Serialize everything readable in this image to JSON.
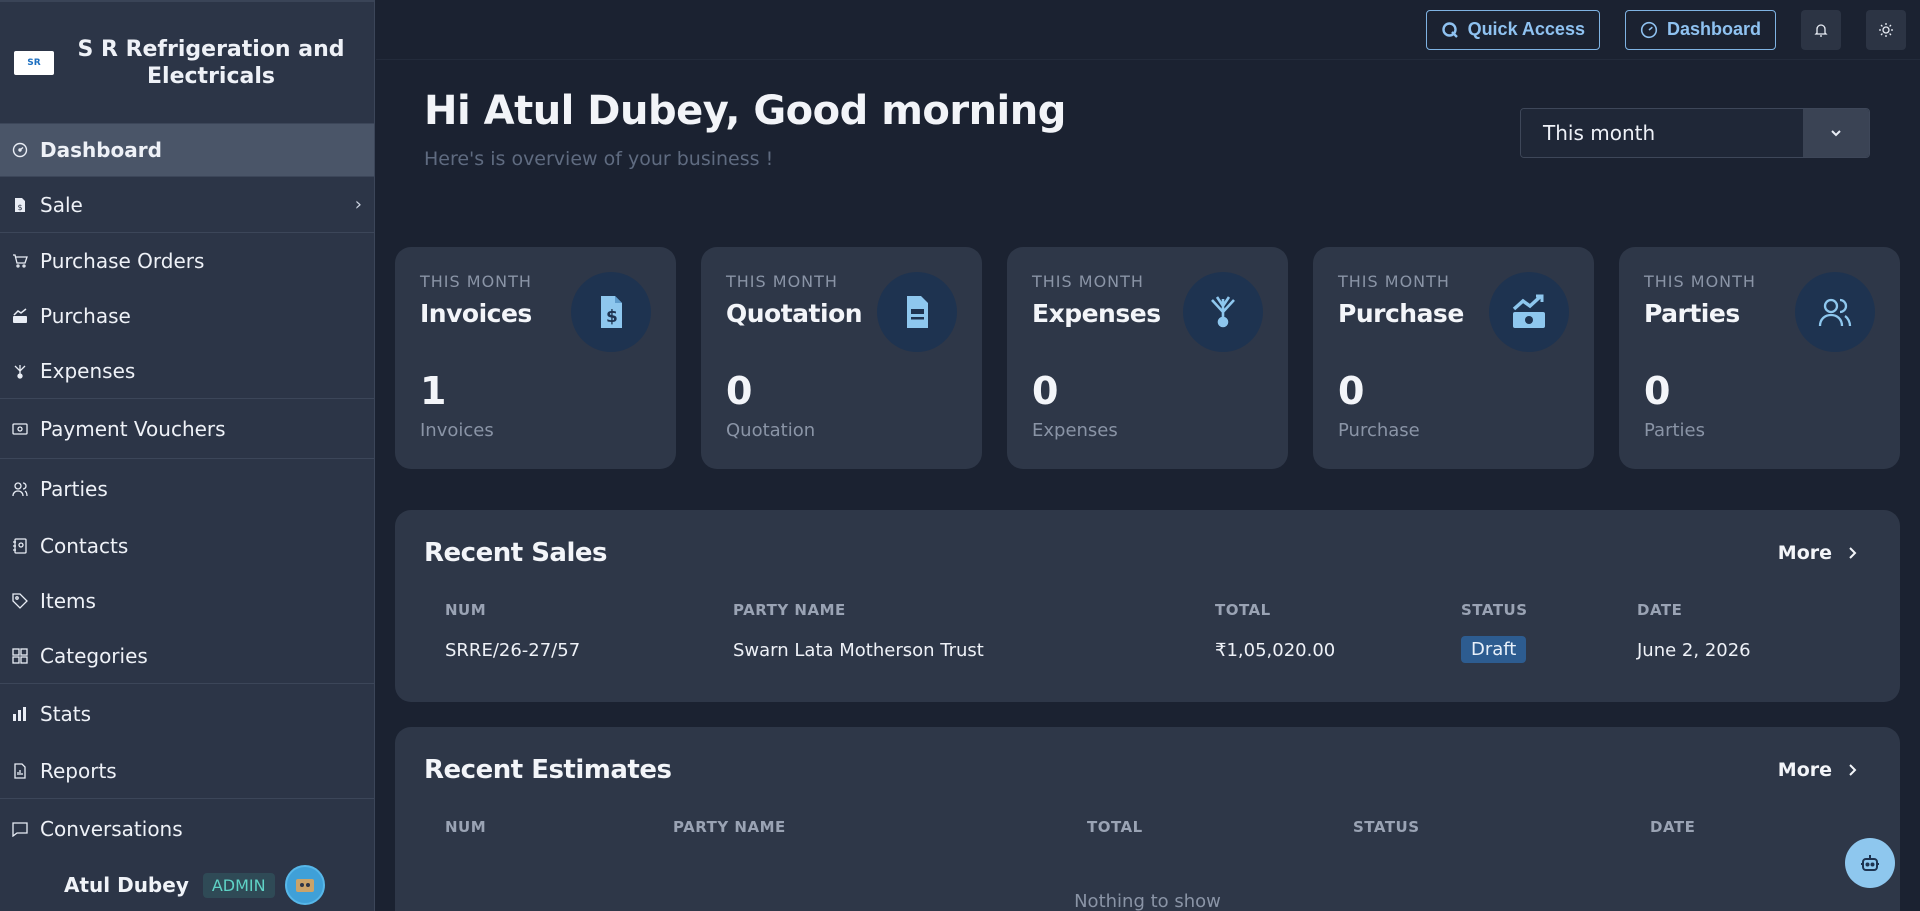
{
  "brand": {
    "name": "S R Refrigeration and Electricals",
    "logo_text": "SR"
  },
  "sidebar": {
    "items": [
      {
        "label": "Dashboard",
        "icon": "gauge-icon",
        "active": true
      },
      {
        "label": "Sale",
        "icon": "invoice-dollar-icon",
        "has_submenu": true
      },
      {
        "label": "Purchase Orders",
        "icon": "cart-icon"
      },
      {
        "label": "Purchase",
        "icon": "cash-chart-icon"
      },
      {
        "label": "Expenses",
        "icon": "expense-icon"
      },
      {
        "label": "Payment Vouchers",
        "icon": "voucher-icon"
      },
      {
        "label": "Parties",
        "icon": "users-icon"
      },
      {
        "label": "Contacts",
        "icon": "contact-book-icon"
      },
      {
        "label": "Items",
        "icon": "tag-icon"
      },
      {
        "label": "Categories",
        "icon": "grid-icon"
      },
      {
        "label": "Stats",
        "icon": "bar-chart-icon"
      },
      {
        "label": "Reports",
        "icon": "report-icon"
      },
      {
        "label": "Conversations",
        "icon": "chat-icon"
      }
    ],
    "user": {
      "name": "Atul Dubey",
      "role": "ADMIN"
    }
  },
  "topbar": {
    "quick_access": "Quick Access",
    "dashboard": "Dashboard"
  },
  "greeting": {
    "title": "Hi Atul Dubey, Good morning",
    "subtitle": "Here's is overview of your business !"
  },
  "period": {
    "selected": "This month"
  },
  "cards": [
    {
      "small": "THIS MONTH",
      "title": "Invoices",
      "value": "1",
      "sub": "Invoices",
      "icon": "invoice-dollar-icon"
    },
    {
      "small": "THIS MONTH",
      "title": "Quotation",
      "value": "0",
      "sub": "Quotation",
      "icon": "quotation-icon"
    },
    {
      "small": "THIS MONTH",
      "title": "Expenses",
      "value": "0",
      "sub": "Expenses",
      "icon": "expense-icon"
    },
    {
      "small": "THIS MONTH",
      "title": "Purchase",
      "value": "0",
      "sub": "Purchase",
      "icon": "cash-chart-icon"
    },
    {
      "small": "THIS MONTH",
      "title": "Parties",
      "value": "0",
      "sub": "Parties",
      "icon": "users-icon"
    }
  ],
  "recent_sales": {
    "title": "Recent Sales",
    "more": "More",
    "columns": [
      "NUM",
      "PARTY NAME",
      "TOTAL",
      "STATUS",
      "DATE"
    ],
    "rows": [
      {
        "num": "SRRE/26-27/57",
        "party": "Swarn Lata Motherson Trust",
        "total": "₹1,05,020.00",
        "status": "Draft",
        "date": "June 2, 2026"
      }
    ]
  },
  "recent_estimates": {
    "title": "Recent Estimates",
    "more": "More",
    "columns": [
      "NUM",
      "PARTY NAME",
      "TOTAL",
      "STATUS",
      "DATE"
    ],
    "empty": "Nothing to show"
  },
  "colors": {
    "accent": "#8fc2f1",
    "draft_badge": "#2d5c90",
    "admin_badge": "#5fd3c6"
  }
}
